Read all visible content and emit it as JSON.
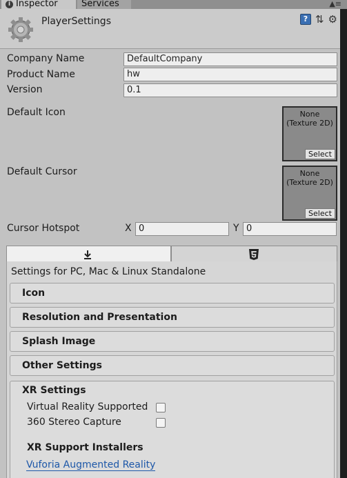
{
  "tabs": {
    "inspector": "Inspector",
    "services": "Services",
    "tools": "▲≡"
  },
  "header": {
    "title": "PlayerSettings",
    "help_glyph": "?",
    "preset_glyph": "⇅",
    "settings_glyph": "⚙"
  },
  "fields": {
    "company_name": {
      "label": "Company Name",
      "value": "DefaultCompany"
    },
    "product_name": {
      "label": "Product Name",
      "value": "hw"
    },
    "version": {
      "label": "Version",
      "value": "0.1"
    }
  },
  "default_icon": {
    "label": "Default Icon",
    "texture_text_line1": "None",
    "texture_text_line2": "(Texture 2D)",
    "select_label": "Select"
  },
  "default_cursor": {
    "label": "Default Cursor",
    "texture_text_line1": "None",
    "texture_text_line2": "(Texture 2D)",
    "select_label": "Select"
  },
  "cursor_hotspot": {
    "label": "Cursor Hotspot",
    "x_label": "X",
    "x_value": "0",
    "y_label": "Y",
    "y_value": "0"
  },
  "platform": {
    "settings_for": "Settings for PC, Mac & Linux Standalone",
    "sections": [
      "Icon",
      "Resolution and Presentation",
      "Splash Image",
      "Other Settings"
    ],
    "xr": {
      "title": "XR Settings",
      "options": [
        {
          "label": "Virtual Reality Supported",
          "checked": false
        },
        {
          "label": "360 Stereo Capture",
          "checked": false
        }
      ],
      "installers_title": "XR Support Installers",
      "vuforia_link": "Vuforia Augmented Reality"
    }
  },
  "colors": {
    "background": "#c2c2c2",
    "link": "#1d57a8",
    "help_icon": "#3a6fb3"
  }
}
